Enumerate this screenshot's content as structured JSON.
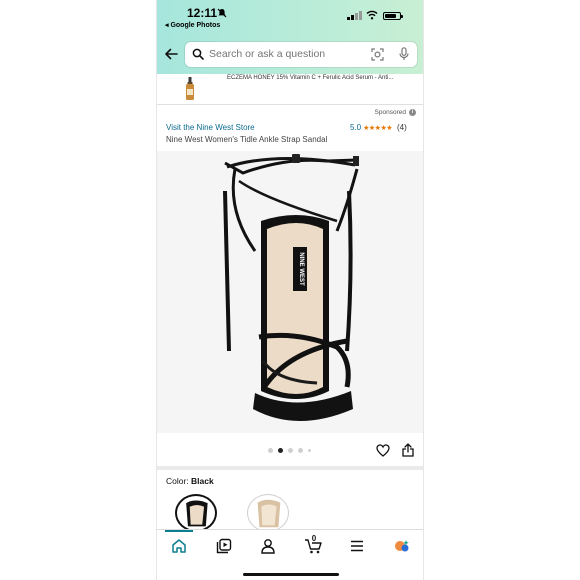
{
  "status_bar": {
    "time": "12:11",
    "back_app": "◂ Google Photos",
    "battery_level": 0.78
  },
  "search": {
    "placeholder": "Search or ask a question"
  },
  "ad_strip": {
    "text": "ECZEMA HONEY 15% Vitamin C + Ferulic Acid Serum - Anti..."
  },
  "sponsored": {
    "label": "Sponsored"
  },
  "product": {
    "store_link": "Visit the Nine West Store",
    "rating_value": "5.0",
    "stars": "★★★★★",
    "rating_count": "(4)",
    "title": "Nine West Women's Tidle Ankle Strap Sandal",
    "insole_brand": "NINE WEST",
    "image_count": 5,
    "active_image_index": 1
  },
  "color": {
    "label": "Color: ",
    "value": "Black"
  },
  "tabbar": {
    "cart_count": "0"
  },
  "colors": {
    "accent": "#0b7e8f",
    "link": "#0b6a8f",
    "star": "#e77600"
  },
  "icons": [
    "back-arrow-icon",
    "search-icon",
    "camera-icon",
    "mic-icon",
    "info-icon",
    "heart-icon",
    "share-icon",
    "home-icon",
    "library-icon",
    "account-icon",
    "cart-icon",
    "menu-icon",
    "ai-assistant-icon"
  ]
}
